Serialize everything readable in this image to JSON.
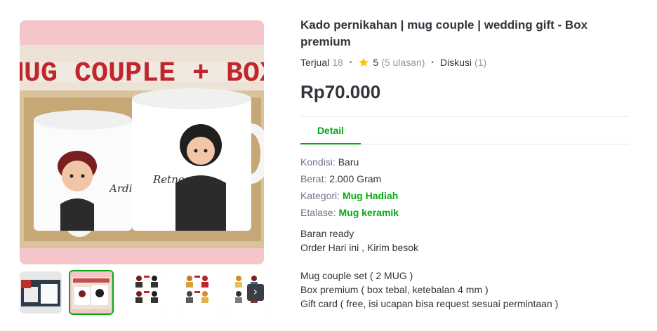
{
  "product": {
    "title": "Kado pernikahan | mug couple | wedding gift - Box premium",
    "sold_label": "Terjual",
    "sold_count": "18",
    "rating": "5",
    "review_count": "(5 ulasan)",
    "discussion_label": "Diskusi",
    "discussion_count": "(1)",
    "price": "Rp70.000"
  },
  "image": {
    "banner_text": "MUG COUPLE + BOX",
    "mug_left_name": "Ardian",
    "mug_right_name": "Retno"
  },
  "thumbnails": {
    "count": 5,
    "active_index": 1
  },
  "tabs": [
    {
      "label": "Detail",
      "active": true
    }
  ],
  "specs": [
    {
      "key": "Kondisi:",
      "value": "Baru",
      "link": false
    },
    {
      "key": "Berat:",
      "value": "2.000 Gram",
      "link": false
    },
    {
      "key": "Kategori:",
      "value": "Mug Hadiah",
      "link": true
    },
    {
      "key": "Etalase:",
      "value": "Mug keramik",
      "link": true
    }
  ],
  "description": [
    "Baran ready",
    "Order Hari ini , Kirim besok",
    "",
    "Mug couple set ( 2 MUG )",
    "Box premium ( box tebal, ketebalan 4 mm )",
    "Gift card ( free, isi ucapan bisa request sesuai permintaan )"
  ],
  "colors": {
    "accent": "#03ac0e",
    "text": "#31353b",
    "muted": "#6d7588",
    "star": "#ffc400",
    "image_bg": "#f4c6c9"
  },
  "icons": {
    "star": "star-icon",
    "next": "chevron-right-icon"
  }
}
